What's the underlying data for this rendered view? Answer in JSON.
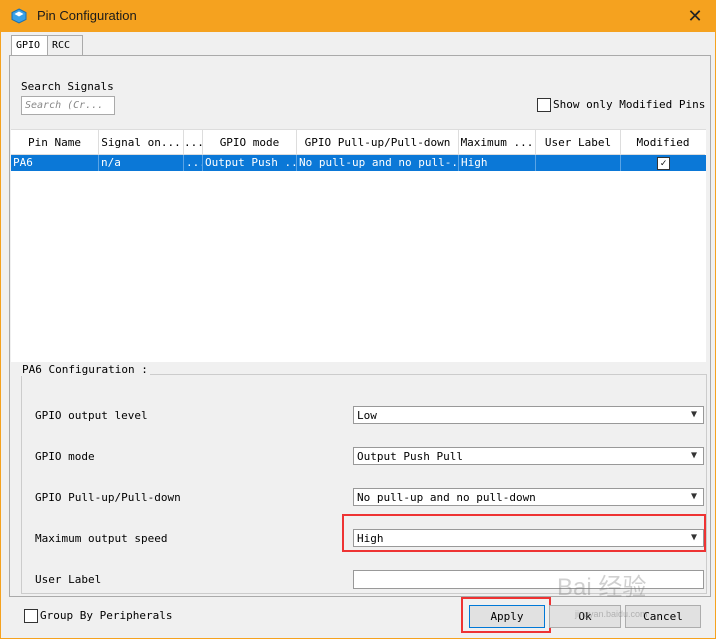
{
  "window": {
    "title": "Pin Configuration",
    "close_glyph": "✕",
    "icon": "cube-icon",
    "accent": "#f5a21f"
  },
  "tabs": [
    {
      "label": "GPIO",
      "active": true
    },
    {
      "label": "RCC",
      "active": false
    }
  ],
  "search": {
    "label": "Search Signals",
    "placeholder": "Search (Cr..."
  },
  "show_modified": {
    "label": "Show only Modified Pins",
    "checked": false
  },
  "table": {
    "columns": [
      "Pin Name",
      "Signal on...",
      "...",
      "GPIO mode",
      "GPIO Pull-up/Pull-down",
      "Maximum ...",
      "User Label",
      "Modified"
    ],
    "rows": [
      {
        "pin": "PA6",
        "signal": "n/a",
        "extra": "...",
        "mode": "Output Push ...",
        "pull": "No pull-up and no pull-...",
        "speed": "High",
        "user_label": "",
        "modified": true
      }
    ],
    "selected_color": "#0b78d7",
    "sort_glyph": "^"
  },
  "config": {
    "title": "PA6 Configuration :",
    "fields": [
      {
        "label": "GPIO output level",
        "value": "Low"
      },
      {
        "label": "GPIO mode",
        "value": "Output Push Pull"
      },
      {
        "label": "GPIO Pull-up/Pull-down",
        "value": "No pull-up and no pull-down"
      },
      {
        "label": "Maximum output speed",
        "value": "High"
      },
      {
        "label": "User Label",
        "value": ""
      }
    ]
  },
  "footer": {
    "group_label": "Group By Peripherals",
    "group_checked": false,
    "apply": "Apply",
    "ok": "Ok",
    "cancel": "Cancel"
  },
  "watermark": {
    "main": "Bai 经验",
    "sub": "jingyan.baidu.com"
  },
  "highlight_color": "#e33333"
}
